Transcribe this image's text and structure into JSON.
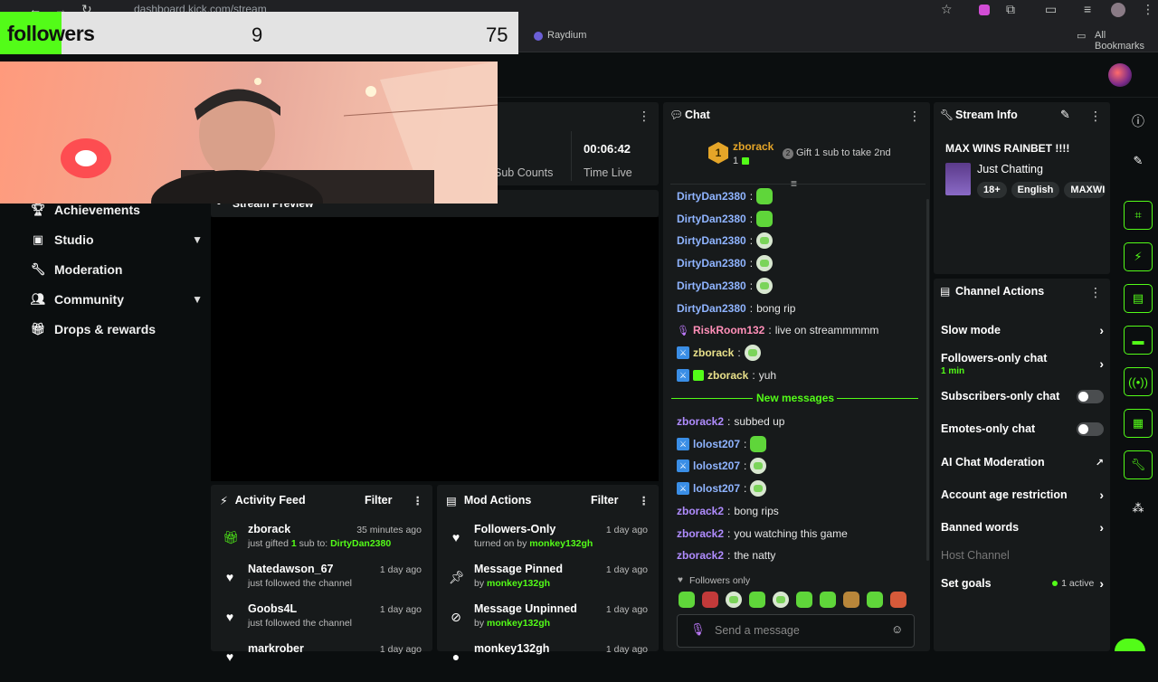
{
  "browser": {
    "url": "dashboard.kick.com/stream",
    "bookmark": "Raydium",
    "all_bookmarks": "All Bookmarks"
  },
  "overlay": {
    "label": "followers",
    "count": "9",
    "goal": "75",
    "progress": 0.12
  },
  "sidebar": {
    "items": [
      {
        "label": "Achievements",
        "icon": "trophy-icon"
      },
      {
        "label": "Studio",
        "icon": "studio-icon",
        "expandable": true
      },
      {
        "label": "Moderation",
        "icon": "wrench-icon"
      },
      {
        "label": "Community",
        "icon": "community-icon",
        "expandable": true
      },
      {
        "label": "Drops & rewards",
        "icon": "gift-icon"
      }
    ]
  },
  "stats": {
    "time_live_value": "00:06:42",
    "time_live_label": "Time Live",
    "sub_counts_label": "Sub Counts"
  },
  "stream_preview": {
    "title": "Stream Preview"
  },
  "chat": {
    "title": "Chat",
    "pinned_user": "zborack",
    "pinned_rank": "1",
    "pinned_subs": "1",
    "gift_prompt": "Gift 1 sub to take 2nd",
    "messages": [
      {
        "user": "DirtyDan2380",
        "text": "",
        "emote": "pepe",
        "color": "#8fb4ff"
      },
      {
        "user": "DirtyDan2380",
        "text": "",
        "emote": "pepe",
        "color": "#8fb4ff"
      },
      {
        "user": "DirtyDan2380",
        "text": "",
        "emote": "face",
        "color": "#8fb4ff"
      },
      {
        "user": "DirtyDan2380",
        "text": "",
        "emote": "face",
        "color": "#8fb4ff"
      },
      {
        "user": "DirtyDan2380",
        "text": "",
        "emote": "face",
        "color": "#8fb4ff"
      },
      {
        "user": "DirtyDan2380",
        "text": " bong rip",
        "emote": "",
        "color": "#8fb4ff"
      },
      {
        "user": "RiskRoom132",
        "text": " live on streammmmm",
        "emote": "",
        "color": "#ff8fb8"
      },
      {
        "user": "zborack",
        "text": "",
        "emote": "face",
        "color": "#e8e08a"
      },
      {
        "user": "zborack",
        "text": " yuh",
        "emote": "",
        "color": "#e8e08a"
      }
    ],
    "new_messages_label": "New messages",
    "new_messages": [
      {
        "user": "zborack2",
        "text": " subbed up",
        "emote": "",
        "color": "#b08cff"
      },
      {
        "user": "lolost207",
        "text": "",
        "emote": "pepe",
        "color": "#8fb4ff"
      },
      {
        "user": "lolost207",
        "text": "",
        "emote": "face",
        "color": "#8fb4ff"
      },
      {
        "user": "lolost207",
        "text": "",
        "emote": "face",
        "color": "#8fb4ff"
      },
      {
        "user": "zborack2",
        "text": " bong rips",
        "emote": "",
        "color": "#b08cff"
      },
      {
        "user": "zborack2",
        "text": " you watching this game",
        "emote": "",
        "color": "#b08cff"
      },
      {
        "user": "zborack2",
        "text": " the natty",
        "emote": "",
        "color": "#b08cff"
      }
    ],
    "followers_only": "Followers only",
    "input_placeholder": "Send a message"
  },
  "activity_feed": {
    "title": "Activity Feed",
    "filter": "Filter",
    "items": [
      {
        "user": "zborack",
        "time": "35 minutes ago",
        "detail_pre": "just gifted ",
        "detail_num": "1",
        "detail_mid": " sub to: ",
        "detail_target": "DirtyDan2380",
        "icon": "gift-icon"
      },
      {
        "user": "Natedawson_67",
        "time": "1 day ago",
        "detail": "just followed the channel",
        "icon": "heart-icon"
      },
      {
        "user": "Goobs4L",
        "time": "1 day ago",
        "detail": "just followed the channel",
        "icon": "heart-icon"
      },
      {
        "user": "markrober",
        "time": "1 day ago",
        "detail": "",
        "icon": "heart-icon"
      }
    ]
  },
  "mod_actions": {
    "title": "Mod Actions",
    "filter": "Filter",
    "items": [
      {
        "title": "Followers-Only",
        "time": "1 day ago",
        "detail": "turned on by ",
        "by": "monkey132gh",
        "icon": "heart-icon"
      },
      {
        "title": "Message Pinned",
        "time": "1 day ago",
        "detail": "by ",
        "by": "monkey132gh",
        "icon": "pin-icon"
      },
      {
        "title": "Message Unpinned",
        "time": "1 day ago",
        "detail": "by ",
        "by": "monkey132gh",
        "icon": "unpin-icon"
      },
      {
        "title": "monkey132gh",
        "time": "1 day ago",
        "detail": "",
        "by": "",
        "icon": "user-icon"
      }
    ]
  },
  "stream_info": {
    "title": "Stream Info",
    "stream_title": "MAX WINS RAINBET !!!!",
    "category": "Just Chatting",
    "tags": [
      "18+",
      "English",
      "MAXWII"
    ]
  },
  "channel_actions": {
    "title": "Channel Actions",
    "slow_mode": "Slow mode",
    "followers_only_chat": "Followers-only chat",
    "followers_only_value": "1 min",
    "subscribers_only_chat": "Subscribers-only chat",
    "emotes_only_chat": "Emotes-only chat",
    "ai_chat_moderation": "AI Chat Moderation",
    "account_age": "Account age restriction",
    "banned_words": "Banned words",
    "host_channel": "Host Channel",
    "set_goals": "Set goals",
    "set_goals_status": "1 active"
  },
  "colors": {
    "accent": "#53fc18",
    "panel": "#171a1b",
    "background": "#0b0e0f"
  }
}
